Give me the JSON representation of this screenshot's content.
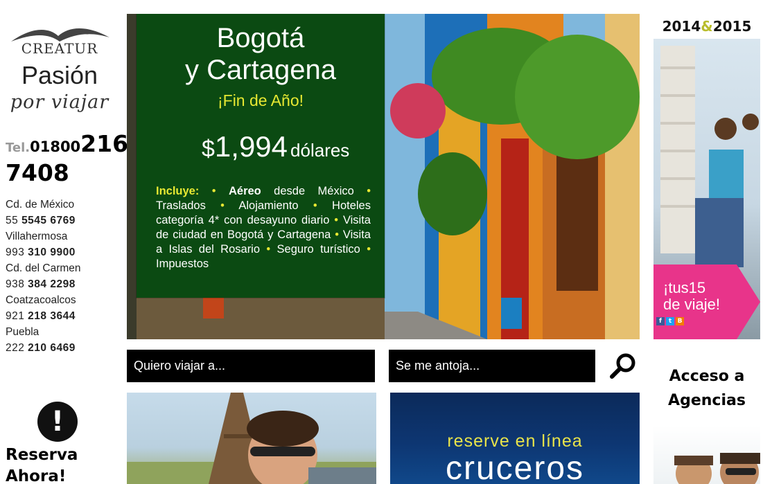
{
  "logo": {
    "brand": "CREATUR",
    "tagline_1": "Pasión",
    "tagline_2": "por viajar"
  },
  "tel": {
    "prefix": "Tel.",
    "part1": "01800",
    "part2": "216",
    "part3": "7408"
  },
  "phones": [
    {
      "city": "Cd. de México",
      "pre": "55 ",
      "number": "5545 6769"
    },
    {
      "city": "Villahermosa",
      "pre": "993 ",
      "number": "310 9900"
    },
    {
      "city": "Cd. del Carmen",
      "pre": "938 ",
      "number": "384 2298"
    },
    {
      "city": "Coatzacoalcos",
      "pre": "921 ",
      "number": "218 3644"
    },
    {
      "city": "Puebla",
      "pre": "222 ",
      "number": "210 6469"
    }
  ],
  "reserva": {
    "icon_glyph": "!",
    "line1": "Reserva",
    "line2": "Ahora!"
  },
  "banner": {
    "title_line1": "Bogotá",
    "title_line2": "y Cartagena",
    "subtitle": "¡Fin de Año!",
    "price_currency": "$",
    "price_amount": "1,994",
    "price_unit": "dólares",
    "includes_label": "Incluye:",
    "includes_items": [
      "Aéreo",
      " desde México",
      "Traslados",
      "Alojamiento",
      "Hoteles categoría 4* con desayuno diario",
      "Visita de ciudad en Bogotá y Cartagena",
      "Visita a Islas del Rosario",
      "Seguro turístico",
      "Impuestos"
    ],
    "colors": {
      "panel": "#0b4a12",
      "accent": "#e7e832"
    }
  },
  "right": {
    "years_a": "2014",
    "years_amp": "&",
    "years_b": "2015",
    "promo_text_1": "¡tus15",
    "promo_text_2": "de viaje!",
    "promo_color": "#e8348a",
    "social_icons": [
      "facebook-icon",
      "twitter-icon",
      "blogger-icon"
    ],
    "acceso_line1": "Acceso a",
    "acceso_line2": "Agencias"
  },
  "search": {
    "destination_placeholder": "Quiero viajar a...",
    "craving_placeholder": "Se me antoja...",
    "icon": "search-icon"
  },
  "tiles": {
    "cruceros_line1": "reserve en línea",
    "cruceros_line2": "cruceros"
  }
}
